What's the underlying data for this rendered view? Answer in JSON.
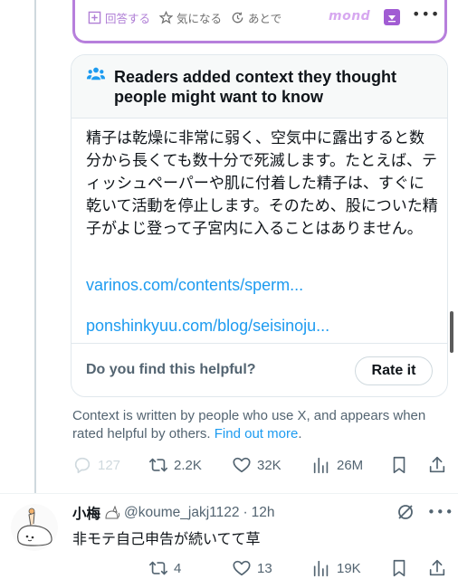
{
  "embed": {
    "answer_label": "回答する",
    "interest_label": "気になる",
    "later_label": "あとで",
    "brand_text": "mond"
  },
  "note": {
    "title": "Readers added context they thought people might want to know",
    "body": "精子は乾燥に非常に弱く、空気中に露出すると数分から長くても数十分で死滅します。たとえば、ティッシュペーパーや肌に付着した精子は、すぐに乾いて活動を停止します。そのため、股についた精子がよじ登って子宮内に入ることはありません。",
    "link1": "varinos.com/contents/sperm...",
    "link2": "ponshinkyuu.com/blog/seisinoju...",
    "helpful_question": "Do you find this helpful?",
    "rate_button": "Rate it"
  },
  "context": {
    "text": "Context is written by people who use X, and appears when rated helpful by others.",
    "link": "Find out more",
    "suffix": "."
  },
  "post_actions": {
    "replies": "127",
    "reposts": "2.2K",
    "likes": "32K",
    "views": "26M"
  },
  "reply": {
    "name": "小梅",
    "handle": "@koume_jakj1122",
    "separator": "·",
    "time": "12h",
    "text": "非モテ自己申告が続いてて草",
    "reposts": "4",
    "likes": "13",
    "views": "19K"
  },
  "colors": {
    "accent_blue": "#1d9bf0",
    "secondary_text": "#536471",
    "embed_purple": "#b77fdc"
  }
}
